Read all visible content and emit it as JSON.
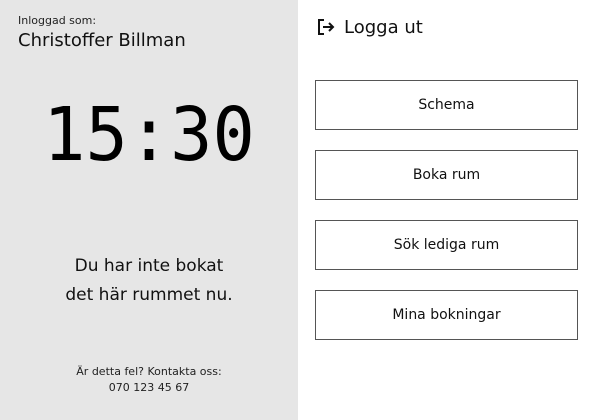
{
  "session": {
    "logged_in_label": "Inloggad som:",
    "user_name": "Christoffer Billman"
  },
  "clock": {
    "time": "15:30"
  },
  "status": {
    "line1": "Du har inte bokat",
    "line2": "det här rummet nu."
  },
  "contact": {
    "prompt": "Är detta fel? Kontakta oss:",
    "phone": "070 123 45 67"
  },
  "logout": {
    "label": "Logga ut",
    "icon": "logout-icon"
  },
  "menu": {
    "items": [
      {
        "label": "Schema"
      },
      {
        "label": "Boka rum"
      },
      {
        "label": "Sök lediga rum"
      },
      {
        "label": "Mina bokningar"
      }
    ]
  },
  "colors": {
    "left_panel_bg": "#e6e6e6",
    "right_panel_bg": "#ffffff",
    "button_border": "#555555",
    "text": "#111111"
  }
}
